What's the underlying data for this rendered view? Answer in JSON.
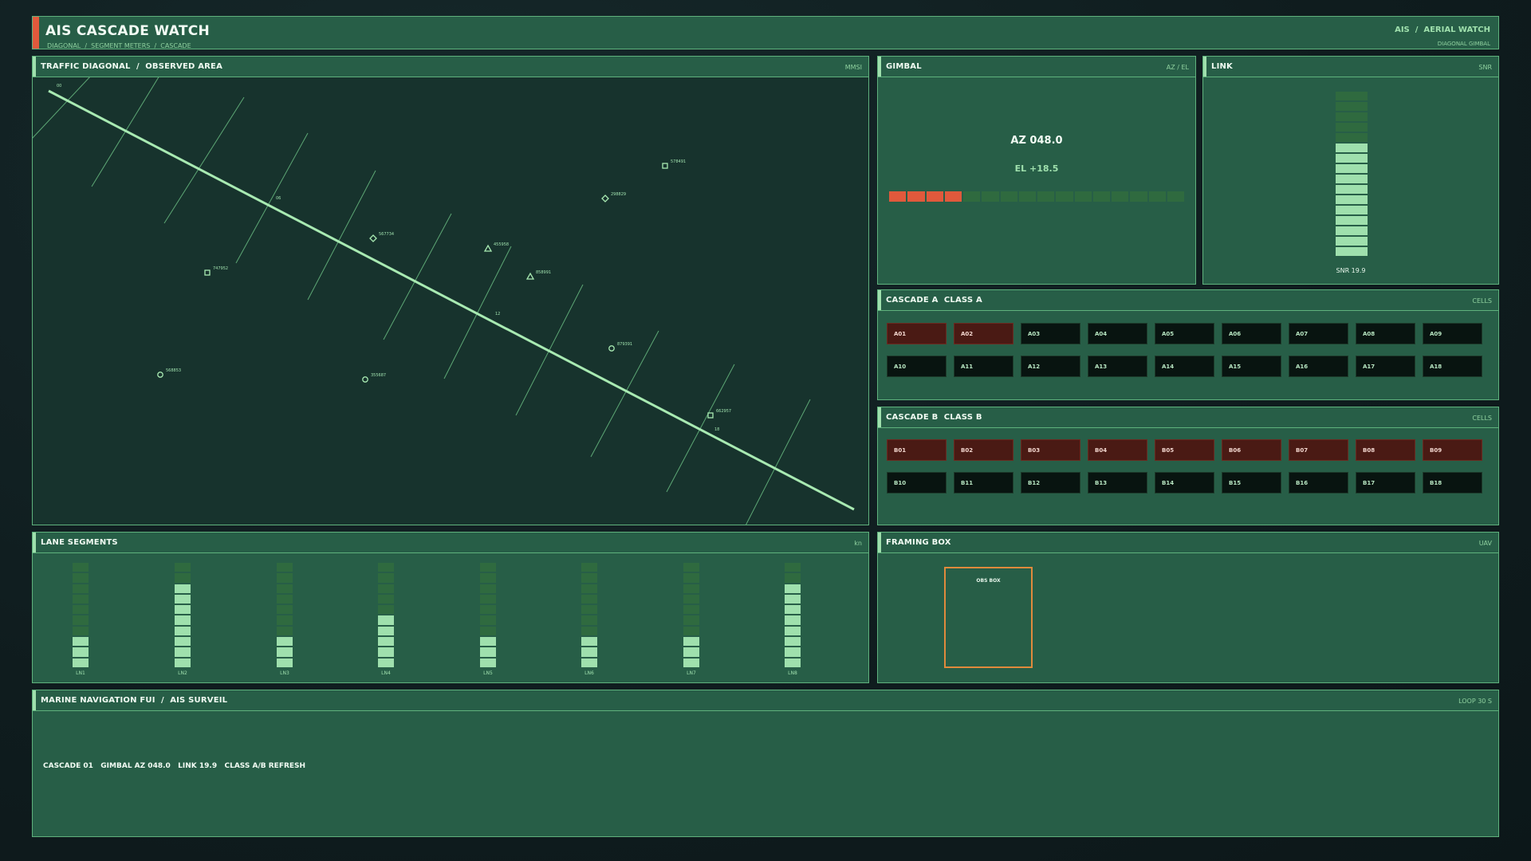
{
  "header": {
    "title": "AIS CASCADE WATCH",
    "breadcrumb": "DIAGONAL  /  SEGMENT METERS  /  CASCADE",
    "right_title": "AIS  /  AERIAL WATCH",
    "right_subtitle": "DIAGONAL  GIMBAL"
  },
  "map": {
    "title": "TRAFFIC DIAGONAL  /  OBSERVED AREA",
    "tag": "MMSI",
    "diagonal_markers": [
      "00",
      "06",
      "12",
      "18"
    ],
    "vessels": [
      {
        "mmsi": "578491",
        "shape": "square"
      },
      {
        "mmsi": "298829",
        "shape": "diamond"
      },
      {
        "mmsi": "567734",
        "shape": "diamond"
      },
      {
        "mmsi": "455958",
        "shape": "triangle"
      },
      {
        "mmsi": "747952",
        "shape": "square"
      },
      {
        "mmsi": "858991",
        "shape": "triangle"
      },
      {
        "mmsi": "879391",
        "shape": "circle"
      },
      {
        "mmsi": "568853",
        "shape": "circle"
      },
      {
        "mmsi": "355687",
        "shape": "circle"
      },
      {
        "mmsi": "662957",
        "shape": "square"
      }
    ]
  },
  "gimbal": {
    "title": "GIMBAL",
    "tag": "AZ / EL",
    "az": "AZ 048.0",
    "el": "EL +18.5",
    "bar_segments": 16,
    "bar_active": 4
  },
  "link": {
    "title": "LINK",
    "tag": "SNR",
    "snr": "SNR 19.9",
    "meter_segments": 16,
    "meter_active": 11
  },
  "cascade_a": {
    "title": "CASCADE A  CLASS A",
    "tag": "CELLS",
    "cells": [
      "A01",
      "A02",
      "A03",
      "A04",
      "A05",
      "A06",
      "A07",
      "A08",
      "A09",
      "A10",
      "A11",
      "A12",
      "A13",
      "A14",
      "A15",
      "A16",
      "A17",
      "A18"
    ],
    "alert": [
      "A01",
      "A02"
    ]
  },
  "cascade_b": {
    "title": "CASCADE B  CLASS B",
    "tag": "CELLS",
    "cells": [
      "B01",
      "B02",
      "B03",
      "B04",
      "B05",
      "B06",
      "B07",
      "B08",
      "B09",
      "B10",
      "B11",
      "B12",
      "B13",
      "B14",
      "B15",
      "B16",
      "B17",
      "B18"
    ],
    "alert": [
      "B01",
      "B02",
      "B03",
      "B04",
      "B05",
      "B06",
      "B07",
      "B08",
      "B09"
    ]
  },
  "lanes": {
    "title": "LANE SEGMENTS",
    "tag": "kn",
    "items": [
      {
        "label": "LN1",
        "filled": 3,
        "total": 10
      },
      {
        "label": "LN2",
        "filled": 8,
        "total": 10
      },
      {
        "label": "LN3",
        "filled": 3,
        "total": 10
      },
      {
        "label": "LN4",
        "filled": 5,
        "total": 10
      },
      {
        "label": "LN5",
        "filled": 3,
        "total": 10
      },
      {
        "label": "LN6",
        "filled": 3,
        "total": 10
      },
      {
        "label": "LN7",
        "filled": 3,
        "total": 10
      },
      {
        "label": "LN8",
        "filled": 8,
        "total": 10
      }
    ]
  },
  "framing": {
    "title": "FRAMING BOX",
    "tag": "UAV",
    "box_label": "OBS BOX"
  },
  "status": {
    "title": "MARINE NAVIGATION FUI  /  AIS SURVEIL",
    "tag": "LOOP 30 S",
    "text": "CASCADE 01   GIMBAL AZ 048.0   LINK 19.9   CLASS A/B REFRESH"
  },
  "colors": {
    "panel": "#275e47",
    "accent_green": "#9fe0ad",
    "alert_red": "#e0593c",
    "alert_cell": "#4a1a14",
    "obs_box": "#e08a3c"
  }
}
